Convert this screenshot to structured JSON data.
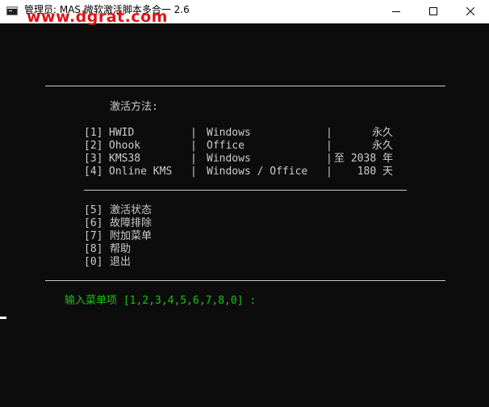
{
  "window": {
    "title": "管理员:  MAS 微软激活脚本多合一 2.6",
    "watermark": "www.dgrat.com",
    "controls": {
      "minimize": "minimize",
      "maximize": "maximize",
      "close": "close"
    }
  },
  "console": {
    "heading": "激活方法:",
    "methods": [
      {
        "num": "[1]",
        "label": "HWID",
        "sep1": "|",
        "target": "Windows",
        "sep2": "|",
        "duration": "永久"
      },
      {
        "num": "[2]",
        "label": "Ohook",
        "sep1": "|",
        "target": "Office",
        "sep2": "|",
        "duration": "永久"
      },
      {
        "num": "[3]",
        "label": "KMS38",
        "sep1": "|",
        "target": "Windows",
        "sep2": "|",
        "duration": "至 2038 年"
      },
      {
        "num": "[4]",
        "label": "Online KMS",
        "sep1": "|",
        "target": "Windows / Office",
        "sep2": "|",
        "duration": "180 天"
      }
    ],
    "menu": [
      {
        "num": "[5]",
        "label": "激活状态"
      },
      {
        "num": "[6]",
        "label": "故障排除"
      },
      {
        "num": "[7]",
        "label": "附加菜单"
      },
      {
        "num": "[8]",
        "label": "帮助"
      },
      {
        "num": "[0]",
        "label": "退出"
      }
    ],
    "prompt": "输入菜单项 [1,2,3,4,5,6,7,8,0] :"
  },
  "colors": {
    "background": "#0c0c0c",
    "text": "#cccccc",
    "prompt": "#16c60c",
    "watermark": "#e01414"
  }
}
